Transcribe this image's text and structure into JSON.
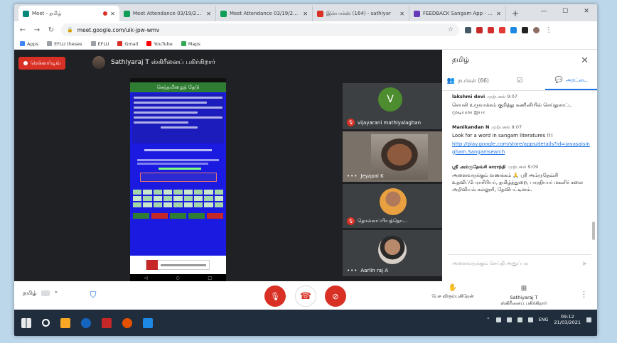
{
  "browser": {
    "tabs": [
      {
        "title": "Meet - தமிழ்",
        "icon_color": "#00897b",
        "active": true,
        "recording": true
      },
      {
        "title": "Meet Attendance 03/19/2021",
        "icon_color": "#0f9d58",
        "active": false
      },
      {
        "title": "Meet Attendance 03/19/2021",
        "icon_color": "#0f9d58",
        "active": false
      },
      {
        "title": "இன்பாக்ஸ் (164) - sathiyar",
        "icon_color": "#d93025",
        "active": false
      },
      {
        "title": "FEEDBACK Sangam App - Go",
        "icon_color": "#673ab7",
        "active": false
      }
    ],
    "new_tab": "+",
    "window_controls": [
      "—",
      "☐",
      "✕"
    ],
    "url": "meet.google.com/uik-jpw-wmv",
    "bookmarks": [
      {
        "label": "Apps",
        "icon_color": "#4285f4"
      },
      {
        "label": "EFLU theses",
        "icon_color": "#9aa0a6"
      },
      {
        "label": "EFLU",
        "icon_color": "#9aa0a6"
      },
      {
        "label": "Gmail",
        "icon_color": "#d93025"
      },
      {
        "label": "YouTube",
        "icon_color": "#ff0000"
      },
      {
        "label": "Maps",
        "icon_color": "#34a853"
      }
    ]
  },
  "meet": {
    "recording_label": "ரெக்கார்டிங்",
    "presenter_text": "Sathiyaraj T ஸ்கிரீனைப் பகிர்கிறார்",
    "shared_screen": {
      "title": "செந்தமிழைத் தேடு"
    },
    "participants": [
      {
        "name": "vijayarani mathiyalaghan",
        "initial": "V",
        "mic_off": true
      },
      {
        "name": "Jeyapal K",
        "mic_off": false
      },
      {
        "name": "தொல்காப்பியத்தொ...",
        "mic_off": true
      },
      {
        "name": "Aarlin raj A",
        "mic_off": false
      }
    ]
  },
  "panel": {
    "title": "தமிழ்",
    "tabs": [
      {
        "label": "நபர்கள் (66)",
        "icon": "👥"
      },
      {
        "label": "",
        "icon": "☑"
      },
      {
        "label": "அரட்டை",
        "icon": "💬"
      }
    ],
    "messages": [
      {
        "sender": "lakshmi devi",
        "time": "முற்பகல் 9:07",
        "text": "செயலி உருவாக்கம் குறித்து கணினியில் செய்துகாட்ட முடியுமா ஐயா"
      },
      {
        "sender": "Manikandan N",
        "time": "முற்பகல் 9:07",
        "text": "Look for a word in sangam literatures !!!",
        "link": "http://play.google.com/store/apps/details?id=jayasaisingham.Sangamsearch"
      },
      {
        "sender": "ஸ்ரீ அம்ருதேவ்சி காராந்தி",
        "time": "முற்பகல் 9:09",
        "text": "அனைவருக்கும் வணக்கம் 🙏 ஸ்ரீ அம்ருதேவ்சி உதவிப்பேராசிரியர், தமிழ்த்துறை, பாரதியார் மகளிர் கலை அறிவியல் கல்லூரி, தேவிபட்டினம்."
      }
    ],
    "input_placeholder": "அனைவருக்கும் செய்தி அனுப்புக"
  },
  "controls": {
    "captions_label": "தமிழ்",
    "raise_hand_label": "பேச விரும்புகிறேன்",
    "present_label_line1": "Sathiyaraj T",
    "present_label_line2": "ஸ்கிரீனைப் பகிர்கிறார்"
  },
  "taskbar": {
    "time": "09:12",
    "date": "21/03/2021",
    "language": "ENG",
    "app_colors": [
      "#f9a825",
      "#1565c0",
      "#c62828",
      "#e65100",
      "#1e88e5"
    ]
  }
}
